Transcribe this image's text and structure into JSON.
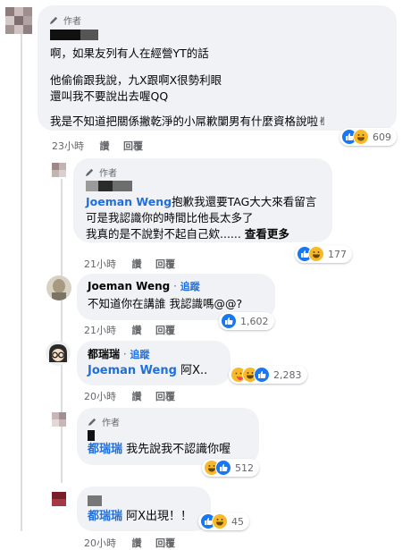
{
  "author_badge": "作者",
  "comments": [
    {
      "id": "c1",
      "lines": [
        "啊，如果友列有人在經營YT的話",
        "他偷偷跟我說，九X跟啊X很勢利眼",
        "還叫我不要說出去喔QQ",
        "我是不知道把關係撇乾淨的小屌歉闌男有什麼資格說啦✌"
      ],
      "time": "23小時",
      "like": "讚",
      "reply": "回覆",
      "reaction_count": "609"
    },
    {
      "id": "c2",
      "mention": "Joeman Weng",
      "lines": [
        "抱歉我還要TAG大大來看留言",
        "可是我認識你的時間比他長太多了",
        "我真的是不說對不起自己欸......"
      ],
      "see_more": "查看更多",
      "time": "21小時",
      "like": "讚",
      "reply": "回覆",
      "reaction_count": "177"
    },
    {
      "id": "c3",
      "name": "Joeman Weng",
      "follow": "追蹤",
      "lines": [
        "不知道你在講誰 我認識嗎@@?"
      ],
      "time": "21小時",
      "like": "讚",
      "reply": "回覆",
      "reaction_count": "1,602"
    },
    {
      "id": "c4",
      "name": "都瑞瑞",
      "follow": "追蹤",
      "mention": "Joeman Weng",
      "text": "阿X..",
      "time": "20小時",
      "like": "讚",
      "reply": "回覆",
      "reaction_count": "2,283"
    },
    {
      "id": "c5",
      "mention": "都瑞瑞",
      "text": "我先說我不認識你喔",
      "time": "20小時",
      "like": "讚",
      "reply": "回覆",
      "reaction_count": "512"
    },
    {
      "id": "c6",
      "mention": "都瑞瑞",
      "text": "阿X出現！！",
      "time": "20小時",
      "like": "讚",
      "reply": "回覆",
      "reaction_count": "45"
    }
  ],
  "colors": {
    "bubble": "#f0f2f5",
    "link": "#216fdb",
    "meta": "#65676b",
    "like": "#1877f2",
    "haha": "#f7b928"
  },
  "icons": [
    "pen-icon",
    "like-reaction-icon",
    "haha-reaction-icon",
    "care-reaction-icon"
  ]
}
